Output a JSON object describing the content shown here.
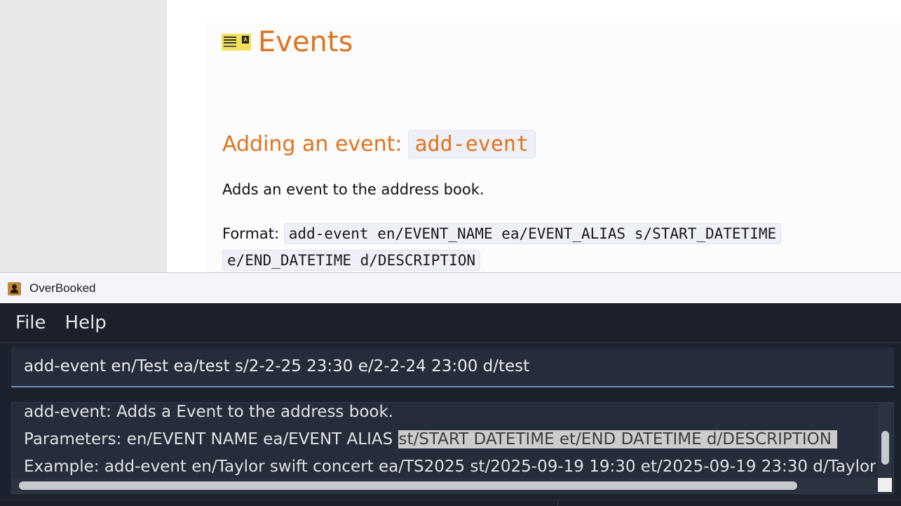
{
  "docs": {
    "title": "Events",
    "section_heading": "Adding an event: ",
    "section_command": "add-event",
    "description": "Adds an event to the address book.",
    "format_label": "Format: ",
    "format_code_line1": "add-event en/EVENT_NAME ea/EVENT_ALIAS s/START_DATETIME",
    "format_code_line2": "e/END_DATETIME d/DESCRIPTION"
  },
  "window": {
    "title": "OverBooked"
  },
  "menu": {
    "file": "File",
    "help": "Help"
  },
  "command_box": {
    "value": "add-event en/Test ea/test s/2-2-25 23:30 e/2-2-24 23:00 d/test"
  },
  "result": {
    "line1": "add-event: Adds a Event to the address book.",
    "line2_plain": "Parameters: en/EVENT NAME ea/EVENT ALIAS ",
    "line2_highlight": "st/START DATETIME et/END DATETIME d/DESCRIPTION",
    "line3": "Example: add-event en/Taylor swift concert ea/TS2025 st/2025-09-19 19:30 et/2025-09-19 23:30 d/Taylor's Swift"
  }
}
